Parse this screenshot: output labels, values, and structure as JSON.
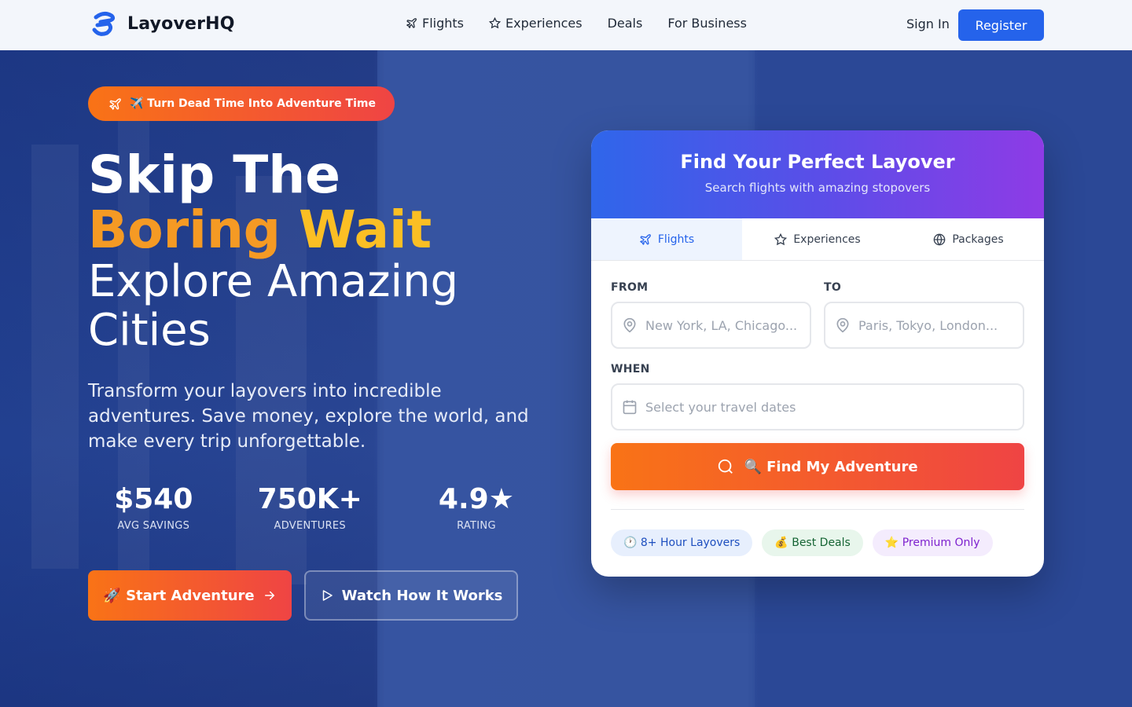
{
  "nav": {
    "brand": "LayoverHQ",
    "links": [
      {
        "label": "Flights",
        "icon": "plane-icon"
      },
      {
        "label": "Experiences",
        "icon": "star-icon"
      },
      {
        "label": "Deals"
      },
      {
        "label": "For Business"
      }
    ],
    "sign_in": "Sign In",
    "register": "Register"
  },
  "hero": {
    "badge": "✈️ Turn Dead Time Into Adventure Time",
    "headline_line1": "Skip The",
    "headline_word_orange": "Boring",
    "headline_word_yellow": "Wait",
    "headline_line3": "Explore Amazing Cities",
    "lead": "Transform your layovers into incredible adventures. Save money, explore the world, and make every trip unforgettable.",
    "stats": [
      {
        "value": "$540",
        "label": "AVG SAVINGS"
      },
      {
        "value": "750K+",
        "label": "ADVENTURES"
      },
      {
        "value": "4.9★",
        "label": "RATING"
      }
    ],
    "cta_primary": "🚀 Start Adventure",
    "cta_secondary": "Watch How It Works"
  },
  "search": {
    "title": "Find Your Perfect Layover",
    "subtitle": "Search flights with amazing stopovers",
    "tabs": [
      {
        "label": "Flights",
        "icon": "plane-icon",
        "active": true
      },
      {
        "label": "Experiences",
        "icon": "star-icon"
      },
      {
        "label": "Packages",
        "icon": "globe-icon"
      }
    ],
    "from_label": "FROM",
    "from_placeholder": "New York, LA, Chicago...",
    "to_label": "TO",
    "to_placeholder": "Paris, Tokyo, London...",
    "when_label": "WHEN",
    "when_placeholder": "Select your travel dates",
    "button": "🔍 Find My Adventure",
    "chips": [
      {
        "label": "🕐 8+ Hour Layovers",
        "color": "#1e4fbf"
      },
      {
        "label": "💰 Best Deals",
        "color": "#166534"
      },
      {
        "label": "⭐ Premium Only",
        "color": "#7e22ce"
      }
    ]
  },
  "colors": {
    "accent_blue": "#2563eb",
    "accent_orange": "#f97316",
    "accent_red": "#ef4444",
    "headline_orange": "#f59a24",
    "headline_yellow": "#fbbf24"
  }
}
